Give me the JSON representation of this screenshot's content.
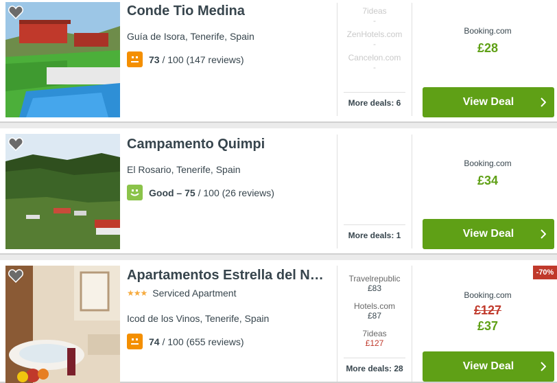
{
  "colors": {
    "accent_green": "#5fa016",
    "rating_orange": "#f48f00",
    "rating_green": "#8bc34a",
    "discount_red": "#c0392b",
    "text": "#37454d"
  },
  "hotels": [
    {
      "name": "Conde Tio Medina",
      "location": "Guía de Isora, Tenerife, Spain",
      "rating_label": "",
      "rating_score": "73",
      "rating_rest": " / 100 (147 reviews)",
      "rating_icon": "neutral-face-icon",
      "providers": [
        {
          "name": "7ideas",
          "price": "-"
        },
        {
          "name": "ZenHotels.com",
          "price": "-"
        },
        {
          "name": "Cancelon.com",
          "price": "-"
        }
      ],
      "more_deals": "More deals: 6",
      "best_site": "Booking.com",
      "price": "£28",
      "button": "View Deal"
    },
    {
      "name": "Campamento Quimpi",
      "location": "El Rosario, Tenerife, Spain",
      "rating_label": "Good – ",
      "rating_score": "75",
      "rating_rest": " / 100 (26 reviews)",
      "rating_icon": "smile-face-icon",
      "more_deals": "More deals: 1",
      "best_site": "Booking.com",
      "price": "£34",
      "button": "View Deal"
    },
    {
      "name": "Apartamentos Estrella del Norte",
      "stars": "★★★",
      "type": "Serviced Apartment",
      "location": "Icod de los Vinos, Tenerife, Spain",
      "rating_label": "",
      "rating_score": "74",
      "rating_rest": " / 100 (655 reviews)",
      "rating_icon": "neutral-face-icon",
      "providers": [
        {
          "name": "Travelrepublic",
          "price": "£83"
        },
        {
          "name": "Hotels.com",
          "price": "£87"
        },
        {
          "name": "7ideas",
          "price": "£127"
        }
      ],
      "more_deals": "More deals: 28",
      "best_site": "Booking.com",
      "old_price": "£127",
      "price": "£37",
      "discount": "-70%",
      "button": "View Deal"
    }
  ]
}
